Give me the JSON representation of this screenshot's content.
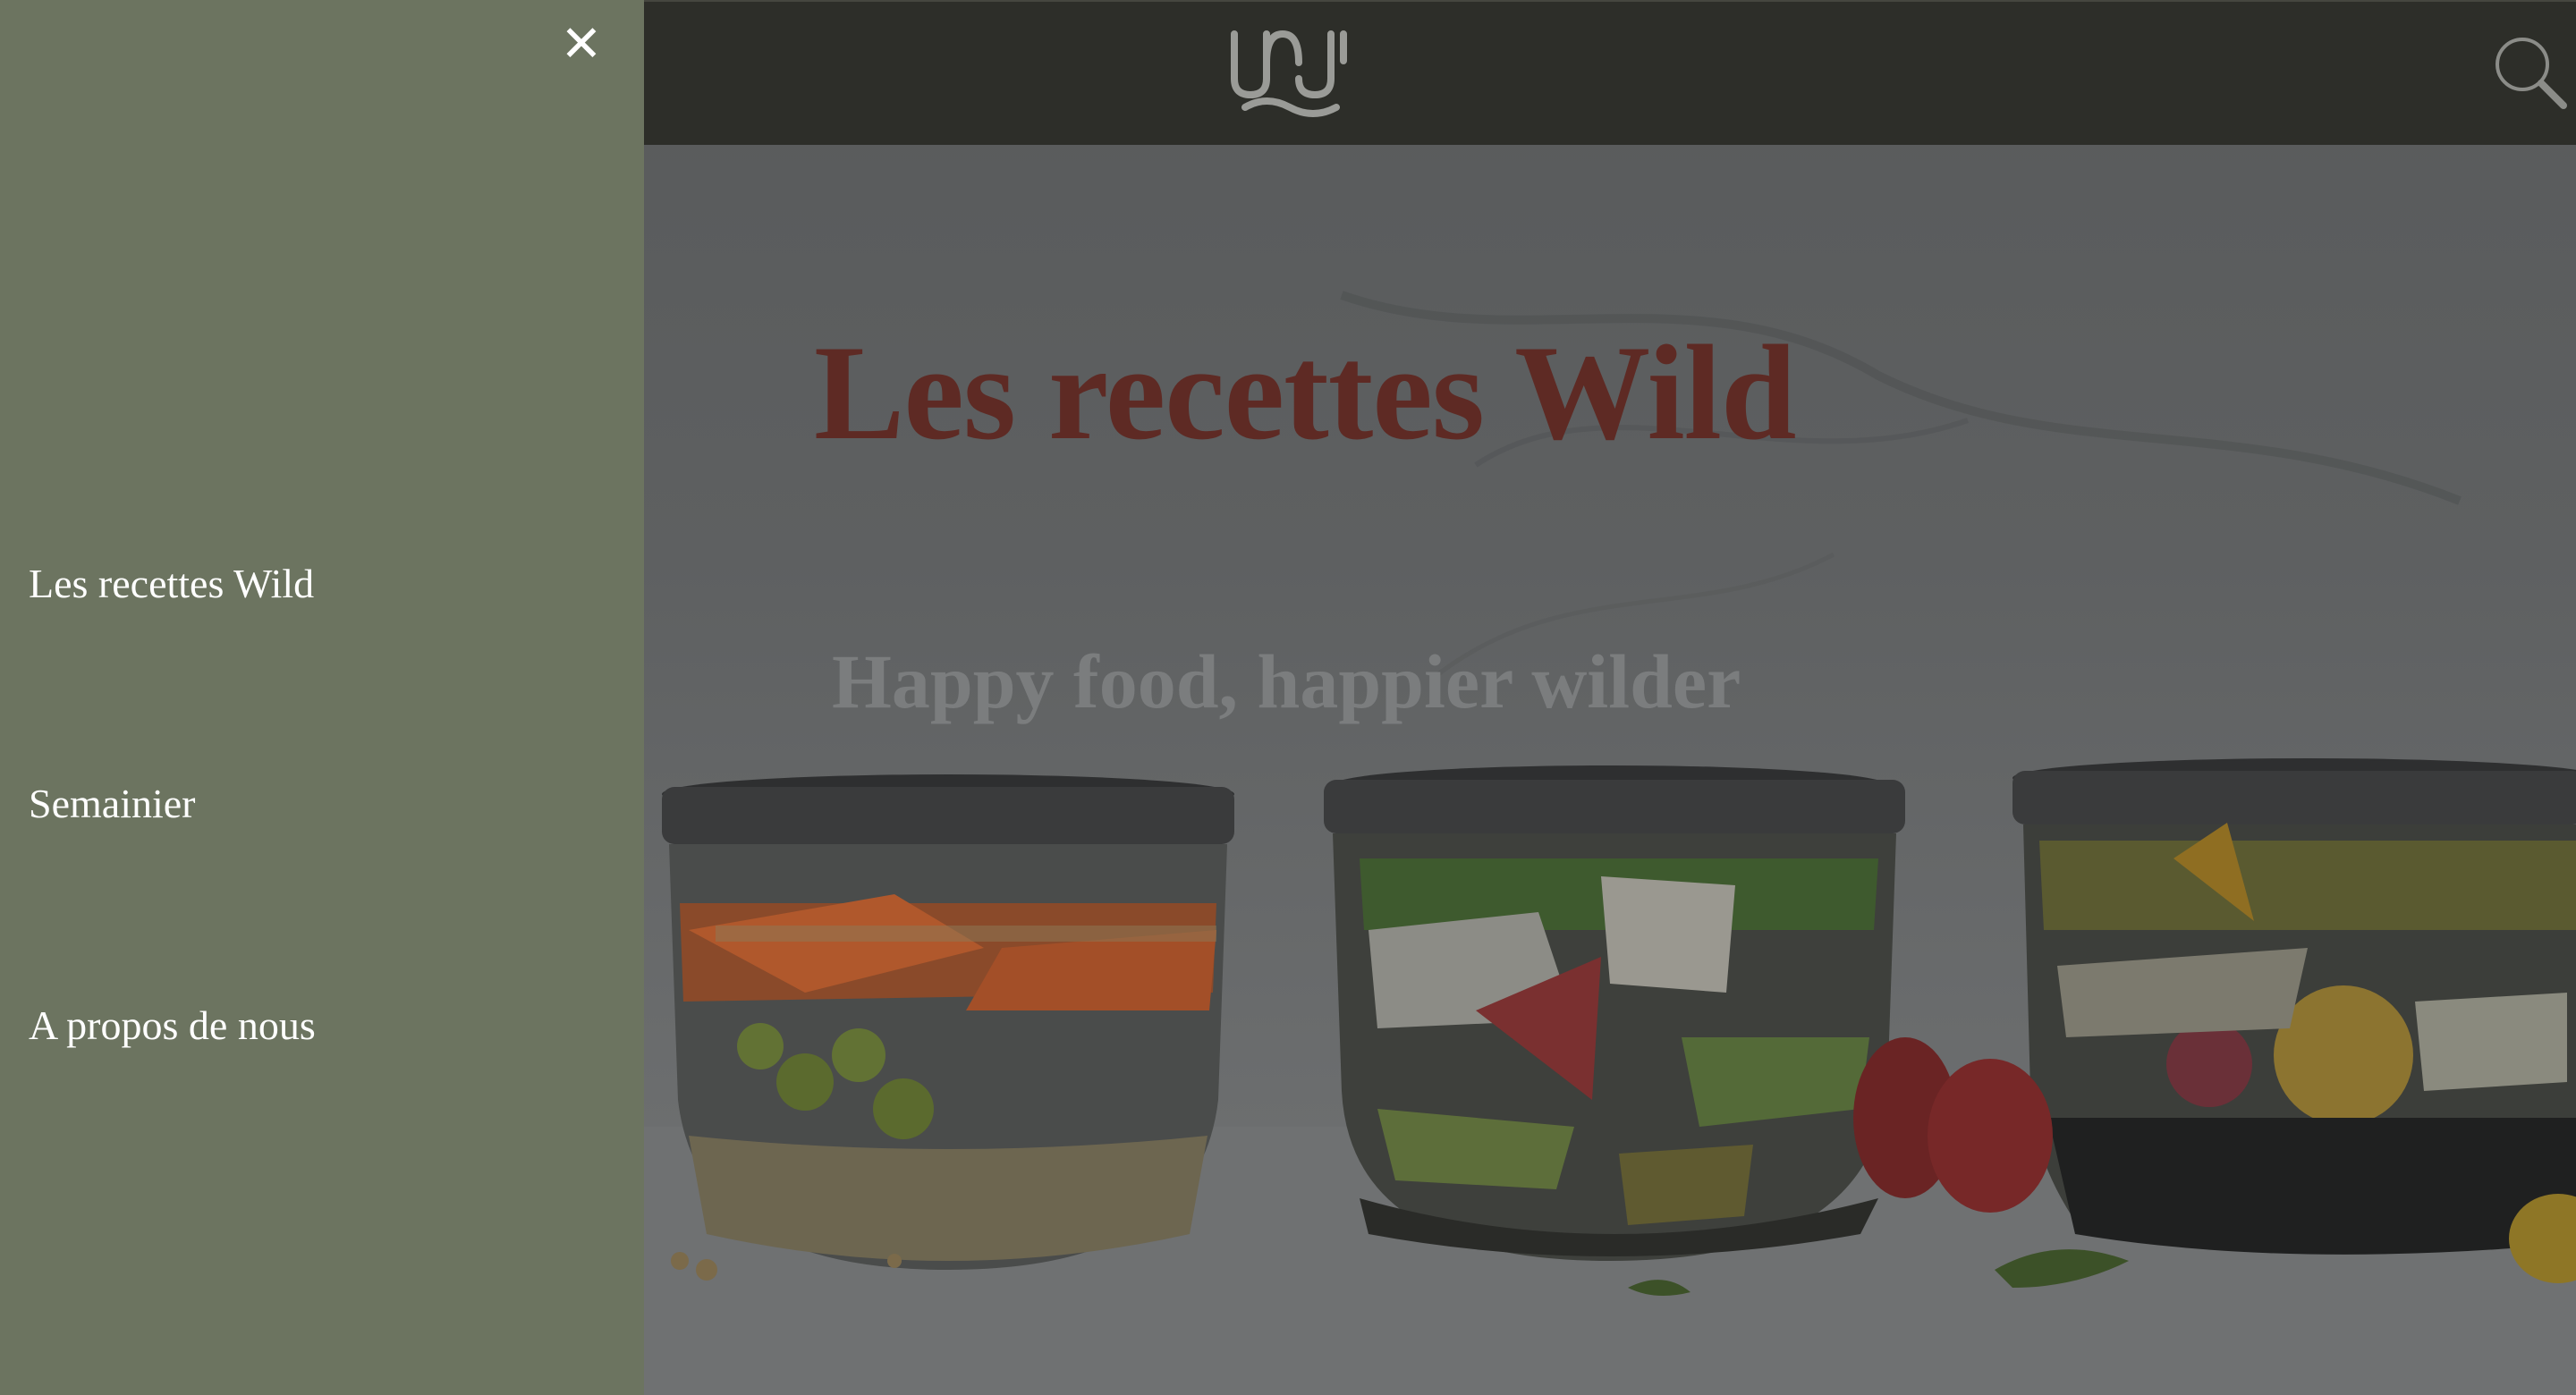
{
  "colors": {
    "topbar": "#2d2e29",
    "drawer": "#6c7460",
    "title": "#5e2a24",
    "subtitle": "#7b7d7e",
    "nav_text": "#ffffff"
  },
  "drawer": {
    "close_icon": "close-icon",
    "close_glyph": "✕",
    "items": [
      {
        "label": "Les recettes Wild"
      },
      {
        "label": "Semainier"
      },
      {
        "label": "A propos de nous"
      }
    ]
  },
  "header": {
    "logo_icon": "wild-logo-icon",
    "search_icon": "search-icon"
  },
  "hero": {
    "title": "Les recettes Wild",
    "subtitle": "Happy food, happier wilder",
    "image": "three glass jars of layered salads"
  }
}
